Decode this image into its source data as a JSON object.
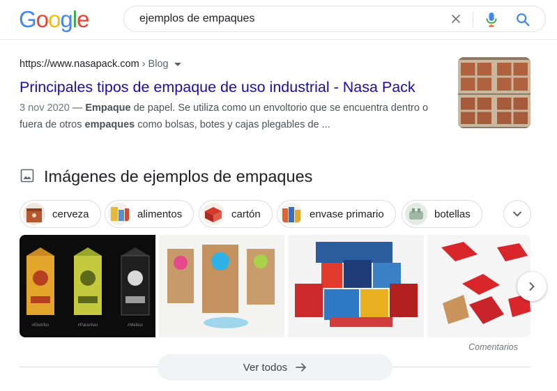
{
  "logo": {
    "letters": [
      "G",
      "o",
      "o",
      "g",
      "l",
      "e"
    ]
  },
  "search": {
    "query": "ejemplos de empaques"
  },
  "result": {
    "url": "https://www.nasapack.com",
    "breadcrumb": " › Blog",
    "title": "Principales tipos de empaque de uso industrial - Nasa Pack",
    "date": "3 nov 2020",
    "snippet": {
      "sep1": " — ",
      "b1": "Empaque",
      "t1": " de papel. Se utiliza como un envoltorio que se encuentra dentro o fuera de otros ",
      "b2": "empaques",
      "t2": " como bolsas, botes y cajas plegables de ..."
    }
  },
  "images_section": {
    "title": "Imágenes de ejemplos de empaques",
    "chips": [
      {
        "label": "cerveza"
      },
      {
        "label": "alimentos"
      },
      {
        "label": "cartón"
      },
      {
        "label": "envase primario"
      },
      {
        "label": "botellas"
      }
    ],
    "tiles": [
      {
        "caption1": "#Eleinfos",
        "caption2": "#Paranhas",
        "caption3": "#Meilius"
      }
    ],
    "feedback": "Comentarios",
    "see_all": "Ver todos"
  },
  "colors": {
    "link": "#1a0dab",
    "google_blue": "#4285f4",
    "google_red": "#ea4335",
    "google_yellow": "#fbbc05",
    "google_green": "#34a853"
  }
}
